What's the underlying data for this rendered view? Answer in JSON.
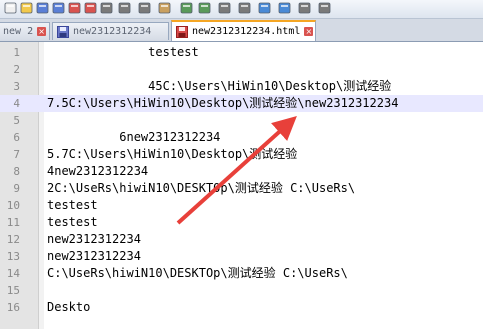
{
  "toolbar": {
    "icons": [
      "new-file-icon",
      "open-file-icon",
      "save-icon",
      "save-all-icon",
      "close-icon",
      "close-all-icon",
      "print-icon",
      "cut-icon",
      "copy-icon",
      "paste-icon",
      "undo-icon",
      "redo-icon",
      "find-icon",
      "replace-icon",
      "zoom-in-icon",
      "zoom-out-icon",
      "sync-icon",
      "wrap-icon"
    ]
  },
  "tabs": [
    {
      "label": "new 2",
      "active": false
    },
    {
      "label": "new2312312234",
      "active": false
    },
    {
      "label": "new2312312234.html",
      "active": true
    }
  ],
  "editor": {
    "current_line": 4,
    "lines": [
      {
        "num": "1",
        "text": "              testest"
      },
      {
        "num": "2",
        "text": ""
      },
      {
        "num": "3",
        "text": "              45C:\\Users\\HiWin10\\Desktop\\测试经验"
      },
      {
        "num": "4",
        "text": "7.5C:\\Users\\HiWin10\\Desktop\\测试经验\\new2312312234"
      },
      {
        "num": "5",
        "text": ""
      },
      {
        "num": "6",
        "text": "          6new2312312234"
      },
      {
        "num": "7",
        "text": "5.7C:\\Users\\HiWin10\\Desktop\\测试经验"
      },
      {
        "num": "8",
        "text": "4new2312312234"
      },
      {
        "num": "9",
        "text": "2C:\\UseRs\\hiwiN10\\DESKTOp\\测试经验 C:\\UseRs\\"
      },
      {
        "num": "10",
        "text": "testest"
      },
      {
        "num": "11",
        "text": "testest"
      },
      {
        "num": "12",
        "text": "new2312312234"
      },
      {
        "num": "13",
        "text": "new2312312234"
      },
      {
        "num": "14",
        "text": "C:\\UseRs\\hiwiN10\\DESKTOp\\测试经验 C:\\UseRs\\"
      },
      {
        "num": "15",
        "text": ""
      },
      {
        "num": "16",
        "text": "Deskto"
      }
    ]
  },
  "annotation": {
    "color": "#e8403a"
  }
}
